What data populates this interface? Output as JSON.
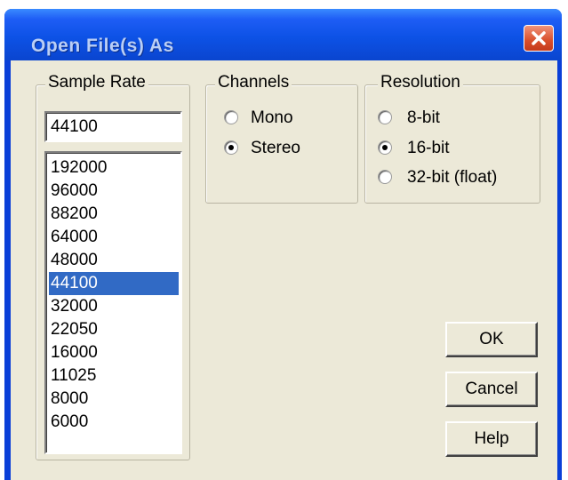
{
  "dialog": {
    "title": "Open File(s) As"
  },
  "sample_rate": {
    "legend": "Sample Rate",
    "value": "44100",
    "items": [
      "192000",
      "96000",
      "88200",
      "64000",
      "48000",
      "44100",
      "32000",
      "22050",
      "16000",
      "11025",
      "8000",
      "6000"
    ],
    "selected": "44100"
  },
  "channels": {
    "legend": "Channels",
    "options": [
      {
        "label": "Mono",
        "checked": false
      },
      {
        "label": "Stereo",
        "checked": true
      }
    ]
  },
  "resolution": {
    "legend": "Resolution",
    "options": [
      {
        "label": "8-bit",
        "checked": false
      },
      {
        "label": "16-bit",
        "checked": true
      },
      {
        "label": "32-bit (float)",
        "checked": false
      }
    ]
  },
  "buttons": {
    "ok": "OK",
    "cancel": "Cancel",
    "help": "Help"
  }
}
